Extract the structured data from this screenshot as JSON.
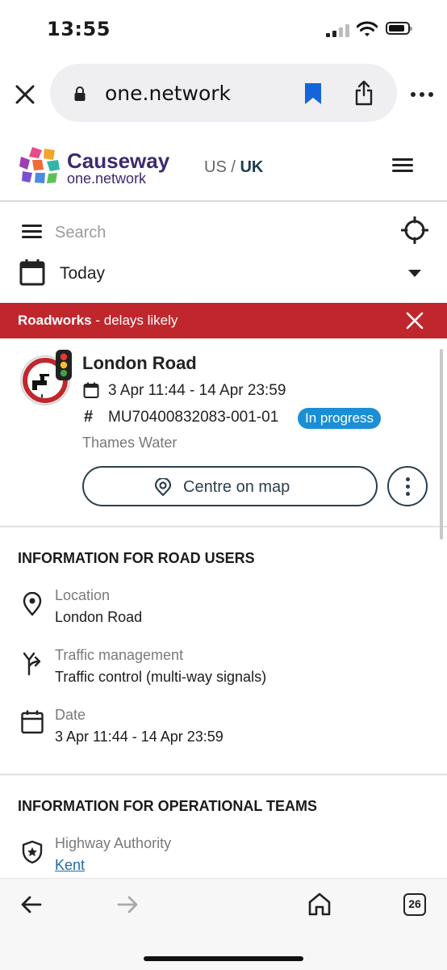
{
  "status_bar": {
    "time": "13:55"
  },
  "browser": {
    "url": "one.network",
    "tab_count": "26"
  },
  "site": {
    "brand_title": "Causeway",
    "brand_sub": "one.network",
    "region_us": "US",
    "region_sep": "/",
    "region_uk": "UK"
  },
  "search": {
    "placeholder": "Search"
  },
  "date_filter": {
    "value": "Today"
  },
  "alert": {
    "type": "Roadworks",
    "message": "- delays likely",
    "color": "#c0272d"
  },
  "event": {
    "title": "London Road",
    "dates": "3 Apr 11:44 - 14 Apr 23:59",
    "hash": "#",
    "reference": "MU70400832083-001-01",
    "status": "In progress",
    "status_color": "#1a8fd6",
    "organisation": "Thames Water",
    "centre_label": "Centre on map"
  },
  "road_users": {
    "title": "INFORMATION FOR ROAD USERS",
    "items": [
      {
        "icon": "location-pin-icon",
        "label": "Location",
        "value": "London Road"
      },
      {
        "icon": "turn-arrow-icon",
        "label": "Traffic management",
        "value": "Traffic control (multi-way signals)"
      },
      {
        "icon": "calendar-icon",
        "label": "Date",
        "value": "3 Apr 11:44 - 14 Apr 23:59"
      }
    ]
  },
  "operational": {
    "title": "INFORMATION FOR OPERATIONAL TEAMS",
    "items": [
      {
        "icon": "shield-star-icon",
        "label": "Highway Authority",
        "value": "Kent"
      }
    ]
  }
}
